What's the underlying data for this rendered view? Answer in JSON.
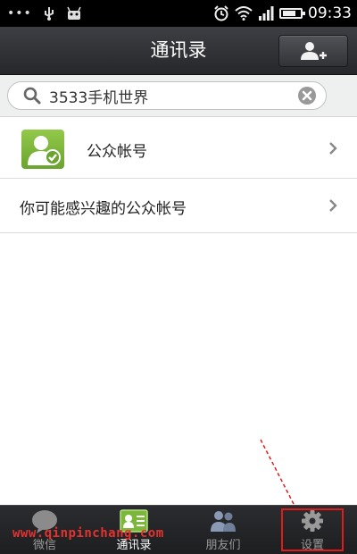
{
  "status_bar": {
    "dots": "•••",
    "time": "09:33",
    "icons": [
      "usb-icon",
      "android-debug-icon",
      "alarm-icon",
      "wifi-icon",
      "signal-icon",
      "battery-icon"
    ]
  },
  "header": {
    "title": "通讯录",
    "add_button_icon": "add-contact-icon"
  },
  "search": {
    "value": "3533手机世界",
    "icon": "search-icon",
    "clear_icon": "clear-icon"
  },
  "list": {
    "items": [
      {
        "label": "公众帐号",
        "icon": "public-account-icon"
      },
      {
        "label": "你可能感兴趣的公众帐号"
      }
    ]
  },
  "tabs": [
    {
      "label": "微信",
      "icon": "chat-bubble-icon",
      "active": false
    },
    {
      "label": "通讯录",
      "icon": "contacts-card-icon",
      "active": true
    },
    {
      "label": "朋友们",
      "icon": "friends-icon",
      "active": false
    },
    {
      "label": "设置",
      "icon": "gear-icon",
      "active": false
    }
  ],
  "watermark": "www.qinpinchang.com",
  "colors": {
    "accent_green": "#7bb83a",
    "highlight_red": "#e01b1b",
    "title_bar": "#2f3034"
  }
}
